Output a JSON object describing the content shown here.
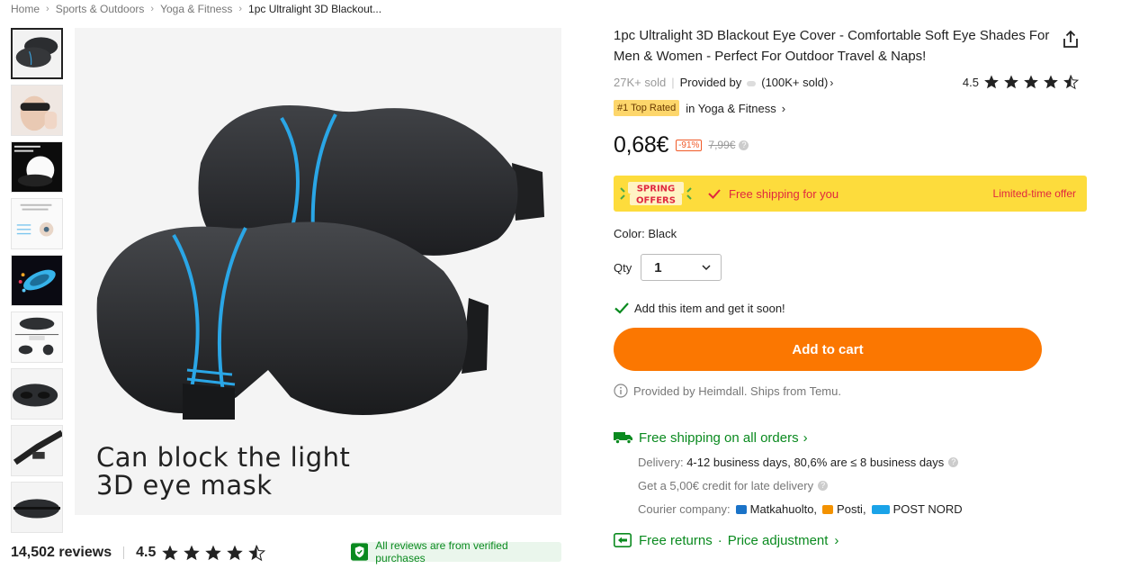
{
  "breadcrumb": {
    "items": [
      "Home",
      "Sports & Outdoors",
      "Yoga & Fitness",
      "1pc Ultralight 3D Blackout..."
    ]
  },
  "main_image": {
    "caption_line1": "Can block the light",
    "caption_line2": "3D eye mask"
  },
  "reviews": {
    "count": "14,502 reviews",
    "rating": "4.5",
    "verified": "All reviews are from verified purchases"
  },
  "product": {
    "title": "1pc Ultralight 3D Blackout Eye Cover - Comfortable Soft Eye Shades For Men & Women - Perfect For Outdoor Travel & Naps!",
    "sold": "27K+ sold",
    "provided_by": "Provided by",
    "provider_sold": "(100K+ sold)",
    "rating": "4.5",
    "rating_value": 4.5,
    "top_badge": "#1 Top Rated",
    "top_category": "in Yoga & Fitness",
    "price": "0,68€",
    "discount": "-91%",
    "original_price": "7,99€"
  },
  "promo": {
    "free_shipping": "Free shipping for you",
    "limited": "Limited-time offer"
  },
  "options": {
    "color_label": "Color:",
    "color_value": "Black",
    "qty_label": "Qty",
    "qty_value": "1"
  },
  "cart": {
    "soon_text": "Add this item and get it soon!",
    "button_label": "Add to cart",
    "provided_text": "Provided by Heimdall. Ships from Temu."
  },
  "shipping": {
    "header": "Free shipping on all orders",
    "delivery_label": "Delivery:",
    "delivery_value": "4-12 business days, 80,6% are ≤ 8 business days",
    "credit_text": "Get a 5,00€ credit for late delivery",
    "courier_label": "Courier company:",
    "couriers": [
      "Matkahuolto,",
      "Posti,",
      "POST NORD"
    ]
  },
  "returns": {
    "label1": "Free returns",
    "sep": "·",
    "label2": "Price adjustment"
  },
  "colors": {
    "accent_orange": "#fb7701",
    "green": "#0a8a1f",
    "promo_yellow": "#fddc3c",
    "promo_red": "#e0283f"
  }
}
